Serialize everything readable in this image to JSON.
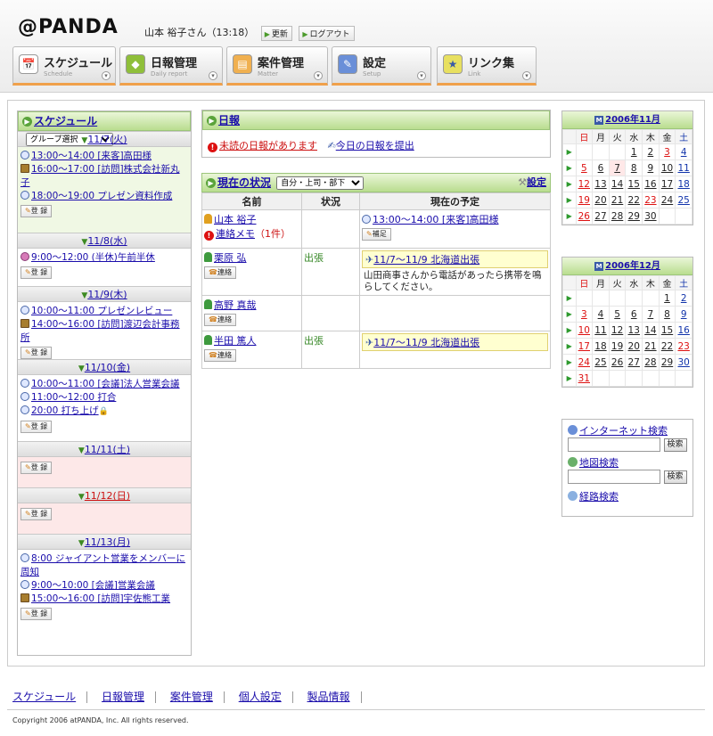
{
  "header": {
    "logo": "@PANDA",
    "user": "山本 裕子さん（13:18）",
    "refresh": "更新",
    "logout": "ログアウト"
  },
  "tabs": [
    {
      "label": "スケジュール",
      "sub": "Schedule",
      "icon": "calendar-icon"
    },
    {
      "label": "日報管理",
      "sub": "Daily report",
      "icon": "report-icon"
    },
    {
      "label": "案件管理",
      "sub": "Matter",
      "icon": "folder-icon"
    },
    {
      "label": "設定",
      "sub": "Setup",
      "icon": "tools-icon"
    },
    {
      "label": "リンク集",
      "sub": "Link",
      "icon": "star-icon"
    }
  ],
  "schedule": {
    "title": "スケジュール",
    "group_select": "グループ選択",
    "register": "登 録",
    "days": [
      {
        "date": "11/7(火)",
        "kind": "today",
        "events": [
          {
            "icon": "clock-icon",
            "text": "13:00～14:00 [来客]高田様"
          },
          {
            "icon": "book-icon",
            "text": "16:00～17:00 [訪問]株式会社新丸子"
          },
          {
            "icon": "clock-icon",
            "text": "18:00～19:00 プレゼン資料作成"
          }
        ]
      },
      {
        "date": "11/8(水)",
        "kind": "normal",
        "events": [
          {
            "icon": "person-icon",
            "text": "9:00～12:00 (半休)午前半休"
          }
        ]
      },
      {
        "date": "11/9(木)",
        "kind": "normal",
        "events": [
          {
            "icon": "clock-icon",
            "text": "10:00～11:00 プレゼンレビュー"
          },
          {
            "icon": "book-icon",
            "text": "14:00～16:00 [訪問]渡辺会計事務所"
          }
        ]
      },
      {
        "date": "11/10(金)",
        "kind": "normal",
        "events": [
          {
            "icon": "clock-icon",
            "text": "10:00～11:00 [会議]法人営業会議"
          },
          {
            "icon": "clock-icon",
            "text": "11:00～12:00 打合"
          },
          {
            "icon": "clock-icon",
            "text": "20:00 打ち上げ",
            "lock": true
          }
        ]
      },
      {
        "date": "11/11(土)",
        "kind": "sat",
        "events": []
      },
      {
        "date": "11/12(日)",
        "kind": "sun",
        "events": []
      },
      {
        "date": "11/13(月)",
        "kind": "normal",
        "events": [
          {
            "icon": "clock-icon",
            "text": "8:00 ジャイアント営業をメンバーに周知"
          },
          {
            "icon": "clock-icon",
            "text": "9:00～10:00 [会議]営業会議"
          },
          {
            "icon": "book-icon",
            "text": "15:00～16:00 [訪問]宇佐熊工業"
          }
        ]
      }
    ]
  },
  "nippo": {
    "title": "日報",
    "unread": "未読の日報があります",
    "submit": "今日の日報を提出"
  },
  "status": {
    "title": "現在の状況",
    "select": "自分・上司・部下",
    "settings": "設定",
    "headers": [
      "名前",
      "状況",
      "現在の予定"
    ],
    "rows": [
      {
        "name": "山本 裕子",
        "self": true,
        "memo": "連絡メモ",
        "memo_count": "（1件）",
        "state": "",
        "plan": "13:00～14:00 [来客]高田様",
        "plan_btn": "補足",
        "note": ""
      },
      {
        "name": "栗原 弘",
        "btn": "連絡",
        "state": "出張",
        "plan": "11/7～11/9 北海道出張",
        "note": "山田商事さんから電話があったら携帯を鳴らしてください。",
        "trip": true
      },
      {
        "name": "高野 真哉",
        "btn": "連絡",
        "state": "",
        "plan": "",
        "note": ""
      },
      {
        "name": "半田 篤人",
        "btn": "連絡",
        "state": "出張",
        "plan": "11/7～11/9 北海道出張",
        "note": "",
        "trip": true
      }
    ]
  },
  "calendars": [
    {
      "title": "2006年11月",
      "weekdays": [
        "日",
        "月",
        "火",
        "水",
        "木",
        "金",
        "土"
      ],
      "weeks": [
        [
          "",
          "",
          "",
          "1",
          "2",
          "3",
          "4"
        ],
        [
          "5",
          "6",
          "7",
          "8",
          "9",
          "10",
          "11"
        ],
        [
          "12",
          "13",
          "14",
          "15",
          "16",
          "17",
          "18"
        ],
        [
          "19",
          "20",
          "21",
          "22",
          "23",
          "24",
          "25"
        ],
        [
          "26",
          "27",
          "28",
          "29",
          "30",
          "",
          ""
        ]
      ],
      "today": "7",
      "holidays": [
        "3",
        "23"
      ]
    },
    {
      "title": "2006年12月",
      "weekdays": [
        "日",
        "月",
        "火",
        "水",
        "木",
        "金",
        "土"
      ],
      "weeks": [
        [
          "",
          "",
          "",
          "",
          "",
          "1",
          "2"
        ],
        [
          "3",
          "4",
          "5",
          "6",
          "7",
          "8",
          "9"
        ],
        [
          "10",
          "11",
          "12",
          "13",
          "14",
          "15",
          "16"
        ],
        [
          "17",
          "18",
          "19",
          "20",
          "21",
          "22",
          "23"
        ],
        [
          "24",
          "25",
          "26",
          "27",
          "28",
          "29",
          "30"
        ],
        [
          "31",
          "",
          "",
          "",
          "",
          "",
          ""
        ]
      ],
      "today": "",
      "holidays": [
        "23"
      ]
    }
  ],
  "search": {
    "internet": "インターネット検索",
    "map": "地図検索",
    "route": "経路検索",
    "button": "検索"
  },
  "footer": {
    "links": [
      "スケジュール",
      "日報管理",
      "案件管理",
      "個人設定",
      "製品情報"
    ],
    "copyright": "Copyright 2006 atPANDA, Inc. All rights reserved."
  }
}
